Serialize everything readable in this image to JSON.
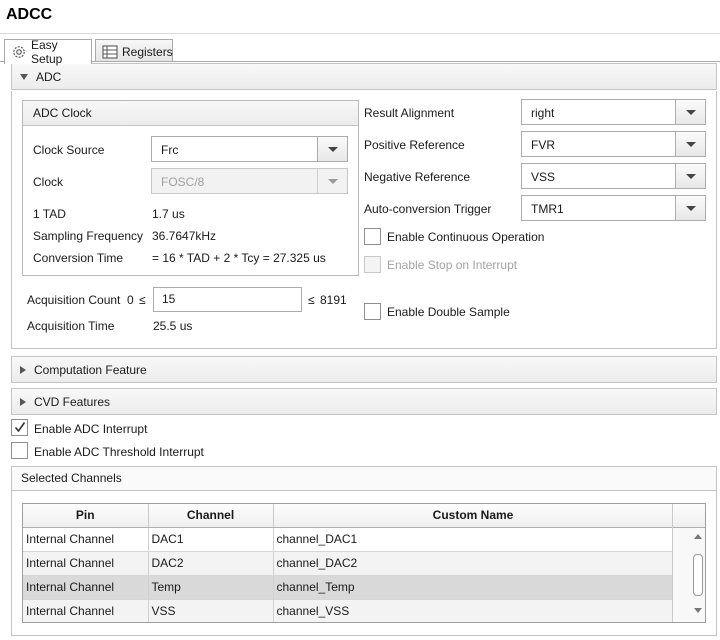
{
  "app": {
    "title": "ADCC"
  },
  "tabs": [
    {
      "label": "Easy Setup",
      "icon": "gear-icon",
      "active": true
    },
    {
      "label": "Registers",
      "icon": "table-icon",
      "active": false
    }
  ],
  "sections": {
    "adc": {
      "label": "ADC",
      "expanded": true
    },
    "computation": {
      "label": "Computation Feature",
      "expanded": false
    },
    "cvd": {
      "label": "CVD Features",
      "expanded": false
    }
  },
  "adc_clock": {
    "title": "ADC Clock",
    "clock_source_label": "Clock Source",
    "clock_source_value": "Frc",
    "clock_label": "Clock",
    "clock_value": "FOSC/8",
    "tad_label": "1 TAD",
    "tad_value": "1.7 us",
    "sampling_label": "Sampling Frequency",
    "sampling_value": "36.7647kHz",
    "conversion_label": "Conversion Time",
    "conversion_value": "= 16 * TAD + 2 * Tcy = 27.325 us"
  },
  "acquisition": {
    "count_label": "Acquisition Count",
    "count_min": "0",
    "le1": "≤",
    "count_value": "15",
    "le2": "≤",
    "count_max": "8191",
    "time_label": "Acquisition Time",
    "time_value": "25.5 us"
  },
  "right_settings": {
    "result_alignment_label": "Result Alignment",
    "result_alignment_value": "right",
    "positive_ref_label": "Positive Reference",
    "positive_ref_value": "FVR",
    "negative_ref_label": "Negative Reference",
    "negative_ref_value": "VSS",
    "auto_trigger_label": "Auto-conversion Trigger",
    "auto_trigger_value": "TMR1",
    "continuous_label": "Enable Continuous Operation",
    "continuous_checked": false,
    "stop_interrupt_label": "Enable Stop on Interrupt",
    "stop_interrupt_checked": false,
    "double_sample_label": "Enable Double Sample",
    "double_sample_checked": false
  },
  "interrupts": {
    "adc_interrupt_label": "Enable ADC Interrupt",
    "adc_interrupt_checked": true,
    "threshold_interrupt_label": "Enable ADC Threshold Interrupt",
    "threshold_interrupt_checked": false
  },
  "channels": {
    "title": "Selected Channels",
    "columns": [
      "Pin",
      "Channel",
      "Custom Name"
    ],
    "rows": [
      [
        "Internal Channel",
        "DAC1",
        "channel_DAC1"
      ],
      [
        "Internal Channel",
        "DAC2",
        "channel_DAC2"
      ],
      [
        "Internal Channel",
        "Temp",
        "channel_Temp"
      ],
      [
        "Internal Channel",
        "VSS",
        "channel_VSS"
      ]
    ],
    "selected_row": 2
  },
  "colors": {
    "border": "#c4c4c4",
    "selected_row": "#d9d9d9",
    "alt_row": "#f3f3f3",
    "disabled_text": "#a3a3a3"
  }
}
